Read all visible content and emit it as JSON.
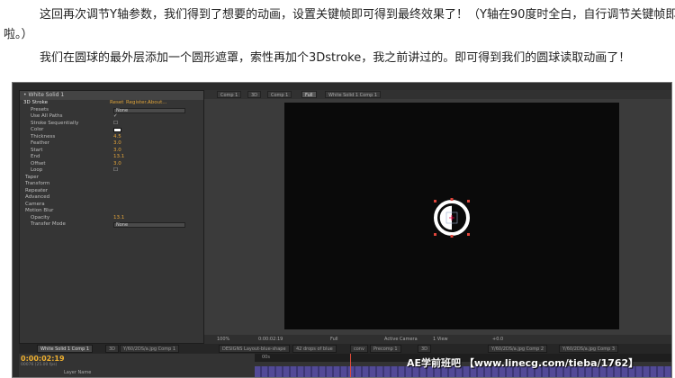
{
  "article": {
    "para1_line1": "这回再次调节Y轴参数，我们得到了想要的动画，设置关键帧即可得到最终效果了！（Y轴在90度时全白，自行调节关键帧即可",
    "para1_line2": "啦。）",
    "para2": "我们在圆球的最外层添加一个圆形遮罩，索性再加个3Dstroke，我之前讲过的。即可得到我们的圆球读取动画了！"
  },
  "effect_panel": {
    "title": "• White Solid 1",
    "effect_name": "3D Stroke",
    "reset": "Reset",
    "register": "Register...",
    "about": "About...",
    "rows": [
      {
        "label": "Presets",
        "type": "dropdown",
        "value": "None"
      },
      {
        "label": "Use All Paths",
        "type": "check",
        "value": "✓"
      },
      {
        "label": "Stroke Sequentially",
        "type": "check",
        "value": "☐"
      },
      {
        "label": "Color",
        "type": "color",
        "value": "#ffffff"
      },
      {
        "label": "Thickness",
        "type": "num",
        "value": "4.5"
      },
      {
        "label": "Feather",
        "type": "num",
        "value": "3.0"
      },
      {
        "label": "Start",
        "type": "num",
        "value": "3.0"
      },
      {
        "label": "End",
        "type": "num",
        "value": "13.1"
      },
      {
        "label": "Offset",
        "type": "num",
        "value": "3.0"
      },
      {
        "label": "Loop",
        "type": "check",
        "value": "☐"
      },
      {
        "label": "Taper",
        "type": "group",
        "value": ""
      },
      {
        "label": "Transform",
        "type": "group",
        "value": ""
      },
      {
        "label": "Repeater",
        "type": "group",
        "value": ""
      },
      {
        "label": "Advanced",
        "type": "group",
        "value": ""
      },
      {
        "label": "Camera",
        "type": "group",
        "value": ""
      },
      {
        "label": "Motion Blur",
        "type": "group",
        "value": ""
      },
      {
        "label": "Opacity",
        "type": "num",
        "value": "13.1"
      },
      {
        "label": "Transfer Mode",
        "type": "dropdown",
        "value": "None"
      }
    ]
  },
  "viewer": {
    "tabs": [
      "Comp 1",
      "3D",
      "Comp 1",
      "Full",
      "White Solid 1 Comp 1"
    ],
    "zoom": "100%",
    "timecode": "0:00:02:19",
    "resolution": "Full",
    "camera": "Active Camera",
    "view": "1 View",
    "exposure": "+0.0"
  },
  "timeline": {
    "tabs": [
      "White Solid 1 Comp 1",
      "3D",
      "Y/60/2DS/a.jpg Comp 1",
      "DESIGNS Layout-blue-shape",
      "42 drops of blue",
      "conv",
      "Precomp 1",
      "3D",
      "Y/60/2DS/a.jpg Comp 2",
      "Y/60/2DS/a.jpg Comp 3"
    ],
    "timecode": "0:00:02:19",
    "timecode_sub": "00076 (25.00 fps)",
    "column": "Layer Name",
    "ruler_label": "00s"
  },
  "watermark": "AE学前班吧 【www.linecg.com/tieba/1762】"
}
